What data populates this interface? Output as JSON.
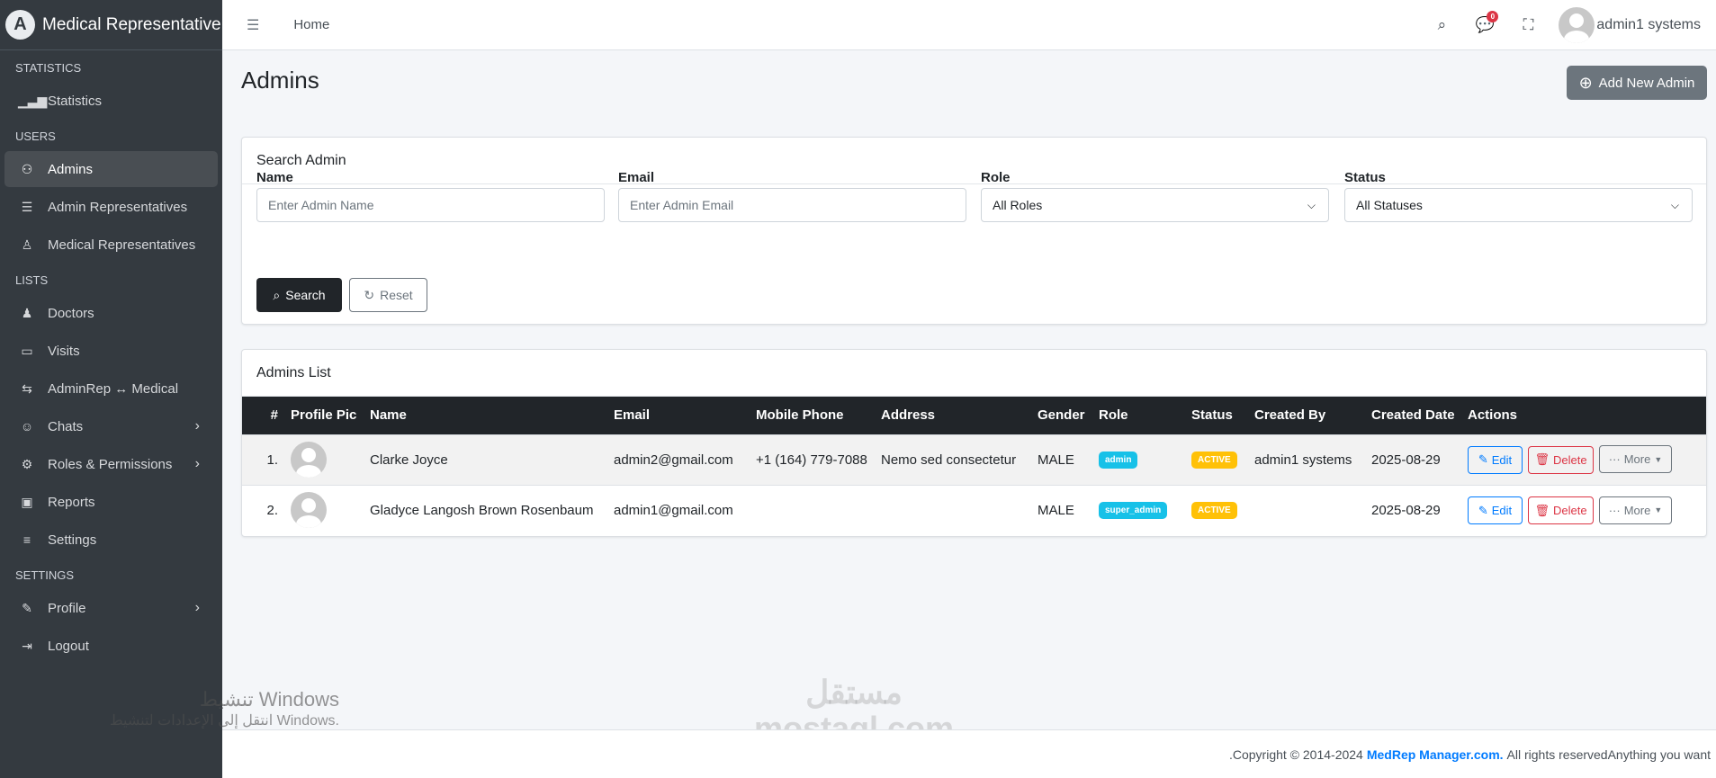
{
  "app": {
    "brand": "Medical Representative",
    "logo_letter": "A"
  },
  "sidebar": {
    "sections": [
      {
        "title": "STATISTICS",
        "items": [
          {
            "label": "Statistics",
            "icon": "bar-chart-icon"
          }
        ]
      },
      {
        "title": "USERS",
        "items": [
          {
            "label": "Admins",
            "icon": "user-gear-icon",
            "active": true
          },
          {
            "label": "Admin Representatives",
            "icon": "user-list-icon"
          },
          {
            "label": "Medical Representatives",
            "icon": "user-icon"
          }
        ]
      },
      {
        "title": "LISTS",
        "items": [
          {
            "label": "Doctors",
            "icon": "doctor-icon"
          },
          {
            "label": "Visits",
            "icon": "briefcase-icon"
          },
          {
            "label": "AdminRep ↔ Medical",
            "icon": "arrows-icon"
          },
          {
            "label": "Chats",
            "icon": "chat-icon",
            "chevron": true
          },
          {
            "label": "Roles & Permissions",
            "icon": "gear-icon",
            "chevron": true
          },
          {
            "label": "Reports",
            "icon": "report-icon"
          },
          {
            "label": "Settings",
            "icon": "sliders-icon"
          }
        ]
      },
      {
        "title": "SETTINGS",
        "items": [
          {
            "label": "Profile",
            "icon": "edit-icon",
            "chevron": true
          },
          {
            "label": "Logout",
            "icon": "logout-icon"
          }
        ]
      }
    ]
  },
  "header": {
    "home": "Home",
    "notifications": "0",
    "user": "admin1 systems"
  },
  "page": {
    "title": "Admins",
    "add_button": "Add New Admin"
  },
  "search": {
    "title": "Search Admin",
    "name_label": "Name",
    "name_placeholder": "Enter Admin Name",
    "email_label": "Email",
    "email_placeholder": "Enter Admin Email",
    "role_label": "Role",
    "role_value": "All Roles",
    "status_label": "Status",
    "status_value": "All Statuses",
    "search_button": "Search",
    "reset_button": "Reset"
  },
  "list": {
    "title": "Admins List",
    "columns": [
      "#",
      "Profile Pic",
      "Name",
      "Email",
      "Mobile Phone",
      "Address",
      "Gender",
      "Role",
      "Status",
      "Created By",
      "Created Date",
      "Actions"
    ],
    "rows": [
      {
        "num": "1.",
        "name": "Clarke Joyce",
        "email": "admin2@gmail.com",
        "phone": "+1 (164) 779-7088",
        "address": "Nemo sed consectetur",
        "gender": "MALE",
        "role": "admin",
        "status": "ACTIVE",
        "created_by": "admin1 systems",
        "created_date": "2025-08-29"
      },
      {
        "num": "2.",
        "name": "Gladyce Langosh Brown Rosenbaum",
        "email": "admin1@gmail.com",
        "phone": "",
        "address": "",
        "gender": "MALE",
        "role": "super_admin",
        "status": "ACTIVE",
        "created_by": "",
        "created_date": "2025-08-29"
      }
    ],
    "actions": {
      "edit": "Edit",
      "delete": "Delete",
      "more": "More"
    }
  },
  "footer": {
    "prefix": "Copyright © 2014-2024",
    "brand": "MedRep Manager.com.",
    "suffix": "All rights reservedAnything you want",
    "lead": "."
  },
  "overlay": {
    "windows_title": "تنشيط Windows",
    "windows_sub": "انتقل إلى الإعدادات لتنشيط Windows.",
    "watermark": "مستقل",
    "watermark_url": "mostaql.com"
  },
  "colors": {
    "sidebar": "#343a40",
    "primary": "#007bff",
    "danger": "#dc3545",
    "info": "#17c1e8",
    "warning": "#ffc107",
    "dark": "#212529"
  }
}
